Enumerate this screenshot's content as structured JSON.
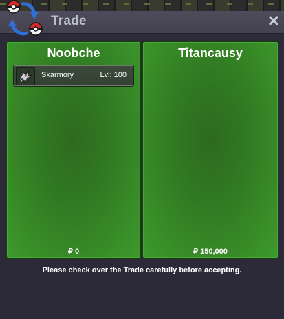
{
  "window": {
    "title": "Trade",
    "close_glyph": "✕"
  },
  "icons": {
    "trade": "trade-icon",
    "close": "close-icon",
    "pokemon": "skarmory-icon"
  },
  "left_panel": {
    "player_name": "Noobche",
    "money": "₽ 0",
    "items": [
      {
        "name": "Skarmory",
        "level": "Lvl: 100"
      }
    ]
  },
  "right_panel": {
    "player_name": "Titancausy",
    "money": "₽ 150,000",
    "items": []
  },
  "notice": "Please check over the Trade carefully before accepting.",
  "colors": {
    "panel_green": "#317a22",
    "window_bg": "#2c2a38",
    "titlebar": "#4a4857"
  }
}
